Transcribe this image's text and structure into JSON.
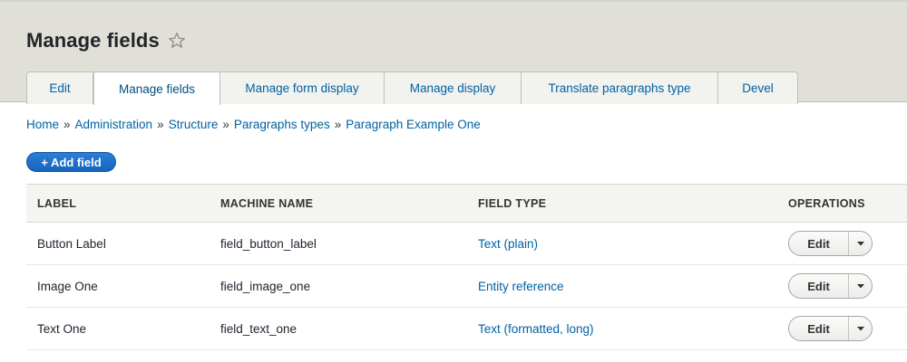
{
  "page": {
    "title": "Manage fields",
    "colors": {
      "header_bg": "#e0e0d8",
      "link": "#0062a3",
      "primary_button": "#1f6ec7"
    }
  },
  "tabs": [
    {
      "label": "Edit",
      "active": false
    },
    {
      "label": "Manage fields",
      "active": true
    },
    {
      "label": "Manage form display",
      "active": false
    },
    {
      "label": "Manage display",
      "active": false
    },
    {
      "label": "Translate paragraphs type",
      "active": false
    },
    {
      "label": "Devel",
      "active": false
    }
  ],
  "breadcrumb": {
    "separator": "»",
    "items": [
      "Home",
      "Administration",
      "Structure",
      "Paragraphs types",
      "Paragraph Example One"
    ]
  },
  "add_field": {
    "label": "+ Add field"
  },
  "table": {
    "headers": [
      "Label",
      "Machine name",
      "Field type",
      "Operations"
    ],
    "rows": [
      {
        "label": "Button Label",
        "machine_name": "field_button_label",
        "field_type": "Text (plain)",
        "operation": "Edit"
      },
      {
        "label": "Image One",
        "machine_name": "field_image_one",
        "field_type": "Entity reference",
        "operation": "Edit"
      },
      {
        "label": "Text One",
        "machine_name": "field_text_one",
        "field_type": "Text (formatted, long)",
        "operation": "Edit"
      }
    ]
  },
  "icons": {
    "favorite": "star-outline-icon",
    "dropdown": "caret-down-icon"
  }
}
